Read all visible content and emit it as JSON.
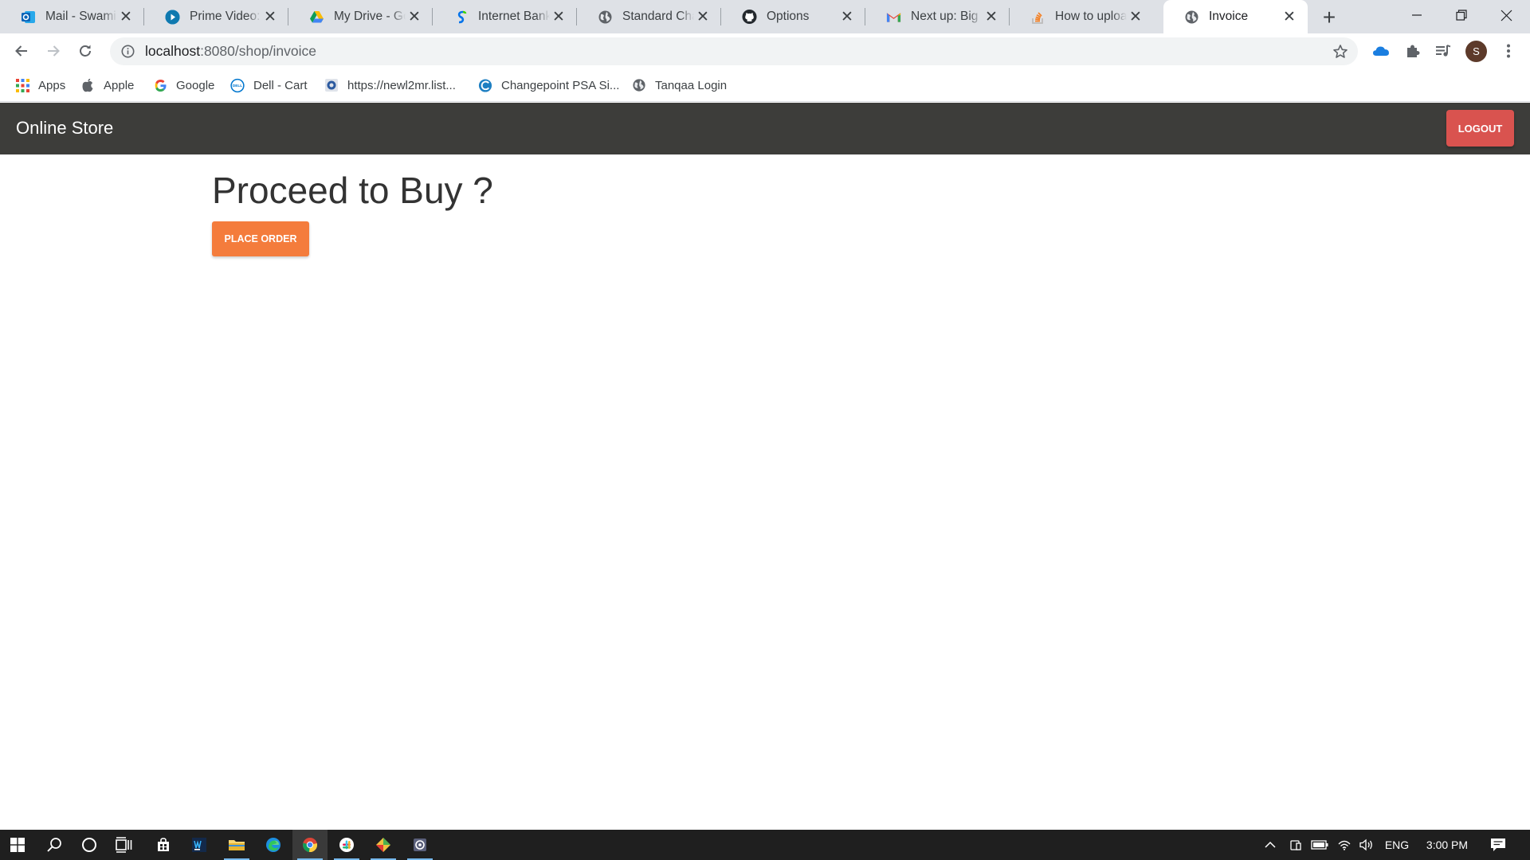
{
  "browser": {
    "tabs": [
      {
        "title": "Mail - Swaminathan",
        "icon": "outlook-icon"
      },
      {
        "title": "Prime Video: The",
        "icon": "prime-video-icon"
      },
      {
        "title": "My Drive - Google Drive",
        "icon": "google-drive-icon"
      },
      {
        "title": "Internet Banking",
        "icon": "bank-icon"
      },
      {
        "title": "Standard Chartered",
        "icon": "globe-icon"
      },
      {
        "title": "Options",
        "icon": "github-icon"
      },
      {
        "title": "Next up: Big Data",
        "icon": "gmail-icon"
      },
      {
        "title": "How to upload",
        "icon": "stackoverflow-icon"
      },
      {
        "title": "Invoice",
        "icon": "globe-icon"
      }
    ],
    "address": {
      "host": "localhost",
      "rest": ":8080/shop/invoice"
    },
    "bookmarks": [
      {
        "label": "Apps",
        "icon": "apps-grid-icon"
      },
      {
        "label": "Apple",
        "icon": "apple-icon"
      },
      {
        "label": "Google",
        "icon": "google-icon"
      },
      {
        "label": "Dell - Cart",
        "icon": "dell-icon"
      },
      {
        "label": "https://newl2mr.list...",
        "icon": "site-icon"
      },
      {
        "label": "Changepoint PSA Si...",
        "icon": "changepoint-icon"
      },
      {
        "label": "Tanqaa Login",
        "icon": "globe-icon"
      }
    ],
    "avatar_initial": "S"
  },
  "page": {
    "brand": "Online Store",
    "logout_label": "LOGOUT",
    "heading": "Proceed to Buy ?",
    "place_order_label": "PLACE ORDER",
    "colors": {
      "navbar": "#3d3d3a",
      "logout": "#d9534f",
      "place_order": "#f47c3c"
    }
  },
  "taskbar": {
    "language": "ENG",
    "time": "3:00 PM"
  }
}
